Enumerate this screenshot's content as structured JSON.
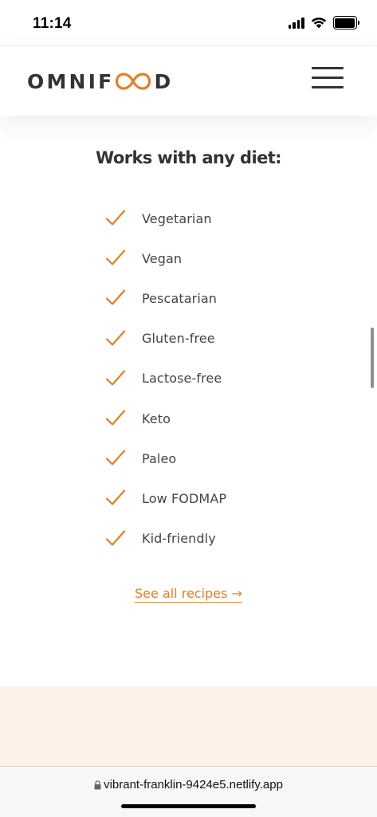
{
  "status_bar": {
    "time": "11:14",
    "icons": [
      "signal-icon",
      "wifi-icon",
      "battery-icon"
    ]
  },
  "header": {
    "logo": {
      "prefix": "OMNIF",
      "suffix": "D",
      "mark_icon": "infinity-icon",
      "mark_color": "#e67e22"
    },
    "menu_icon": "hamburger-menu-icon"
  },
  "diets": {
    "heading": "Works with any diet:",
    "check_icon": "checkmark-icon",
    "check_color": "#e67e22",
    "items": [
      "Vegetarian",
      "Vegan",
      "Pescatarian",
      "Gluten-free",
      "Lactose-free",
      "Keto",
      "Paleo",
      "Low FODMAP",
      "Kid-friendly"
    ],
    "link_label": "See all recipes →",
    "link_color": "#e67e22"
  },
  "next_section": {
    "background": "#fdf2e9"
  },
  "browser": {
    "url": "vibrant-franklin-9424e5.netlify.app",
    "lock_icon": "lock-icon"
  }
}
